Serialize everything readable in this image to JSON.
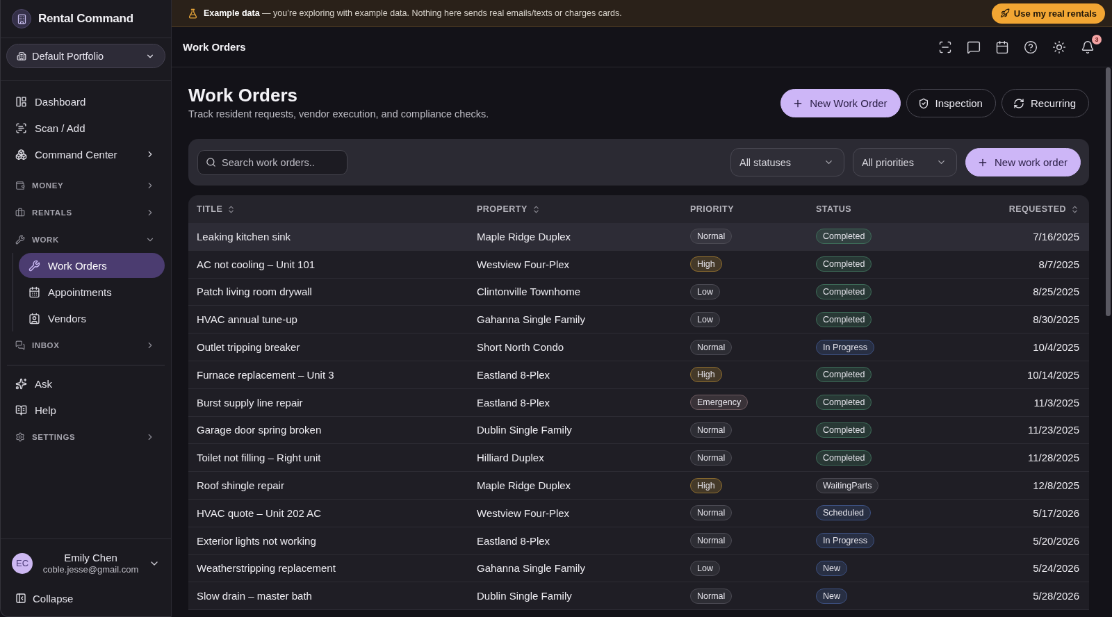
{
  "banner": {
    "message": "**Example data** — you’re exploring with example data. Nothing here sends real emails/texts or charges cards.",
    "action": "Use my real rentals"
  },
  "sidebar": {
    "brand": "Rental Command",
    "portfolio": "Default Portfolio",
    "nav": [
      {
        "kind": "link",
        "label": "Dashboard",
        "selected": false
      },
      {
        "kind": "link",
        "label": "Scan / Add",
        "selected": false
      },
      {
        "kind": "group",
        "label": "Command Center",
        "selected": false,
        "expanded": false
      },
      {
        "kind": "section",
        "label": "MONEY",
        "expanded": false
      },
      {
        "kind": "section",
        "label": "RENTALS",
        "expanded": false
      },
      {
        "kind": "section",
        "label": "WORK",
        "expanded": true,
        "children": [
          {
            "label": "Work Orders",
            "selected": true
          },
          {
            "label": "Appointments",
            "selected": false
          },
          {
            "label": "Vendors",
            "selected": false
          }
        ]
      },
      {
        "kind": "section",
        "label": "INBOX",
        "expanded": false
      }
    ],
    "nav_secondary": [
      {
        "kind": "link",
        "label": "Ask",
        "selected": false
      },
      {
        "kind": "link",
        "label": "Help",
        "selected": false
      },
      {
        "kind": "section",
        "label": "SETTINGS",
        "expanded": false
      }
    ],
    "user": {
      "initials": "EC",
      "name": "Emily Chen",
      "email": "coble.jesse@gmail.com"
    },
    "collapse": "Collapse"
  },
  "topbar": {
    "title": "Work Orders",
    "notifications": "3"
  },
  "page": {
    "title": "Work Orders",
    "subtitle": "Track resident requests, vendor execution, and compliance checks.",
    "actions": [
      {
        "kind": "primary",
        "label": "New Work Order"
      },
      {
        "kind": "outline",
        "label": "Inspection"
      },
      {
        "kind": "outline",
        "label": "Recurring"
      }
    ]
  },
  "toolbar": {
    "search": {
      "placeholder": "Search work orders.."
    },
    "filters": [
      {
        "value": "All statuses"
      },
      {
        "value": "All priorities"
      }
    ],
    "action": "New work order"
  },
  "table": {
    "columns": [
      {
        "label": "TITLE",
        "sortable": true
      },
      {
        "label": "PROPERTY",
        "sortable": true
      },
      {
        "label": "PRIORITY",
        "sortable": false
      },
      {
        "label": "STATUS",
        "sortable": false
      },
      {
        "label": "REQUESTED",
        "sortable": true
      }
    ],
    "rows": [
      {
        "title": "Leaking kitchen sink",
        "property": "Maple Ridge Duplex",
        "priority": {
          "label": "Normal",
          "color": "#4b4a53"
        },
        "status": {
          "label": "Completed",
          "color": "#3d6b58"
        },
        "requested": "7/16/2025",
        "hovered": true
      },
      {
        "title": "AC not cooling – Unit 101",
        "property": "Westview Four-Plex",
        "priority": {
          "label": "High",
          "color": "#8f6e2f"
        },
        "status": {
          "label": "Completed",
          "color": "#3d6b58"
        },
        "requested": "8/7/2025",
        "hovered": false
      },
      {
        "title": "Patch living room drywall",
        "property": "Clintonville Townhome",
        "priority": {
          "label": "Low",
          "color": "#4b4a53"
        },
        "status": {
          "label": "Completed",
          "color": "#3d6b58"
        },
        "requested": "8/25/2025",
        "hovered": false
      },
      {
        "title": "HVAC annual tune-up",
        "property": "Gahanna Single Family",
        "priority": {
          "label": "Low",
          "color": "#4b4a53"
        },
        "status": {
          "label": "Completed",
          "color": "#3d6b58"
        },
        "requested": "8/30/2025",
        "hovered": false
      },
      {
        "title": "Outlet tripping breaker",
        "property": "Short North Condo",
        "priority": {
          "label": "Normal",
          "color": "#4b4a53"
        },
        "status": {
          "label": "In Progress",
          "color": "#3c5080"
        },
        "requested": "10/4/2025",
        "hovered": false
      },
      {
        "title": "Furnace replacement – Unit 3",
        "property": "Eastland 8-Plex",
        "priority": {
          "label": "High",
          "color": "#8f6e2f"
        },
        "status": {
          "label": "Completed",
          "color": "#3d6b58"
        },
        "requested": "10/14/2025",
        "hovered": false
      },
      {
        "title": "Burst supply line repair",
        "property": "Eastland 8-Plex",
        "priority": {
          "label": "Emergency",
          "color": "#6e5a60"
        },
        "status": {
          "label": "Completed",
          "color": "#3d6b58"
        },
        "requested": "11/3/2025",
        "hovered": false
      },
      {
        "title": "Garage door spring broken",
        "property": "Dublin Single Family",
        "priority": {
          "label": "Normal",
          "color": "#4b4a53"
        },
        "status": {
          "label": "Completed",
          "color": "#3d6b58"
        },
        "requested": "11/23/2025",
        "hovered": false
      },
      {
        "title": "Toilet not filling – Right unit",
        "property": "Hilliard Duplex",
        "priority": {
          "label": "Normal",
          "color": "#4b4a53"
        },
        "status": {
          "label": "Completed",
          "color": "#3d6b58"
        },
        "requested": "11/28/2025",
        "hovered": false
      },
      {
        "title": "Roof shingle repair",
        "property": "Maple Ridge Duplex",
        "priority": {
          "label": "High",
          "color": "#8f6e2f"
        },
        "status": {
          "label": "WaitingParts",
          "color": "#4b4a53"
        },
        "requested": "12/8/2025",
        "hovered": false
      },
      {
        "title": "HVAC quote – Unit 202 AC",
        "property": "Westview Four-Plex",
        "priority": {
          "label": "Normal",
          "color": "#4b4a53"
        },
        "status": {
          "label": "Scheduled",
          "color": "#3c5080"
        },
        "requested": "5/17/2026",
        "hovered": false
      },
      {
        "title": "Exterior lights not working",
        "property": "Eastland 8-Plex",
        "priority": {
          "label": "Normal",
          "color": "#4b4a53"
        },
        "status": {
          "label": "In Progress",
          "color": "#3c5080"
        },
        "requested": "5/20/2026",
        "hovered": false
      },
      {
        "title": "Weatherstripping replacement",
        "property": "Gahanna Single Family",
        "priority": {
          "label": "Low",
          "color": "#4b4a53"
        },
        "status": {
          "label": "New",
          "color": "#3c5080"
        },
        "requested": "5/24/2026",
        "hovered": false
      },
      {
        "title": "Slow drain – master bath",
        "property": "Dublin Single Family",
        "priority": {
          "label": "Normal",
          "color": "#4b4a53"
        },
        "status": {
          "label": "New",
          "color": "#3c5080"
        },
        "requested": "5/28/2026",
        "hovered": false
      }
    ]
  }
}
